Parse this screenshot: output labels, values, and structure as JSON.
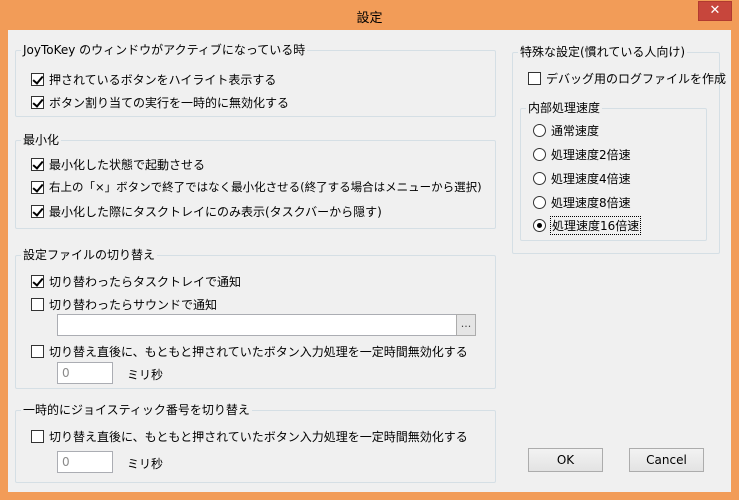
{
  "window": {
    "title": "設定",
    "close_label": "✕"
  },
  "groups": {
    "active": {
      "title": "JoyToKey のウィンドウがアクティブになっている時",
      "items": [
        {
          "label": "押されているボタンをハイライト表示する",
          "checked": true
        },
        {
          "label": "ボタン割り当ての実行を一時的に無効化する",
          "checked": true
        }
      ]
    },
    "minimize": {
      "title": "最小化",
      "items": [
        {
          "label": "最小化した状態で起動させる",
          "checked": true
        },
        {
          "label": "右上の「×」ボタンで終了ではなく最小化させる(終了する場合はメニューから選択)",
          "checked": true
        },
        {
          "label": "最小化した際にタスクトレイにのみ表示(タスクバーから隠す)",
          "checked": true
        }
      ]
    },
    "config_switch": {
      "title": "設定ファイルの切り替え",
      "items": [
        {
          "label": "切り替わったらタスクトレイで通知",
          "checked": true
        },
        {
          "label": "切り替わったらサウンドで通知",
          "checked": false
        },
        {
          "label": "切り替え直後に、もともと押されていたボタン入力処理を一定時間無効化する",
          "checked": false
        }
      ],
      "sound_path": "",
      "browse_label": "...",
      "ms_value": "0",
      "ms_unit": "ミリ秒"
    },
    "joystick_switch": {
      "title": "一時的にジョイスティック番号を切り替え",
      "items": [
        {
          "label": "切り替え直後に、もともと押されていたボタン入力処理を一定時間無効化する",
          "checked": false
        }
      ],
      "ms_value": "0",
      "ms_unit": "ミリ秒"
    },
    "special": {
      "title": "特殊な設定(慣れている人向け)",
      "items": [
        {
          "label": "デバッグ用のログファイルを作成",
          "checked": false
        }
      ],
      "speed": {
        "title": "内部処理速度",
        "options": [
          "通常速度",
          "処理速度2倍速",
          "処理速度4倍速",
          "処理速度8倍速",
          "処理速度16倍速"
        ],
        "selected": "処理速度16倍速"
      }
    }
  },
  "buttons": {
    "ok": "OK",
    "cancel": "Cancel"
  },
  "colors": {
    "title_bar": "#f29c58",
    "close_button": "#c7463c",
    "dialog_bg": "#f0f0f0",
    "group_border": "#d5dfe5"
  }
}
